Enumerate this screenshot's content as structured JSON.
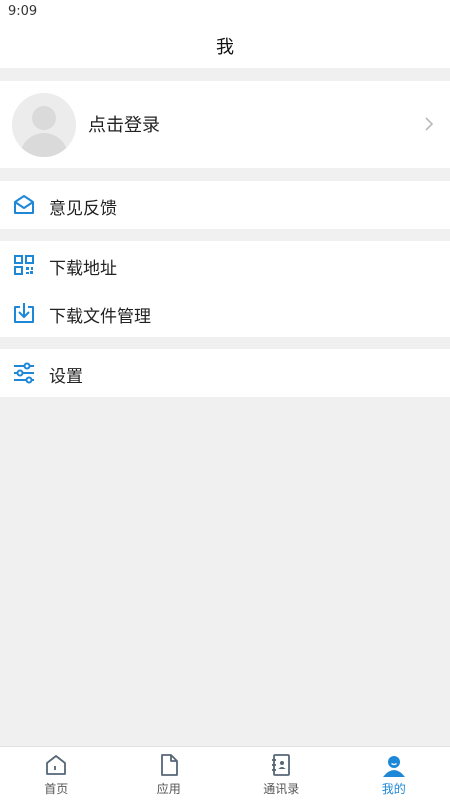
{
  "status": {
    "time": "9:09"
  },
  "header": {
    "title": "我"
  },
  "profile": {
    "login_label": "点击登录"
  },
  "menu": {
    "feedback": "意见反馈",
    "download_address": "下载地址",
    "download_manager": "下载文件管理",
    "settings": "设置"
  },
  "tabs": [
    {
      "label": "首页",
      "icon": "home-icon"
    },
    {
      "label": "应用",
      "icon": "file-icon"
    },
    {
      "label": "通讯录",
      "icon": "contacts-icon"
    },
    {
      "label": "我的",
      "icon": "user-icon",
      "active": true
    }
  ],
  "colors": {
    "accent": "#1e88d8",
    "background": "#f0f0f0"
  }
}
